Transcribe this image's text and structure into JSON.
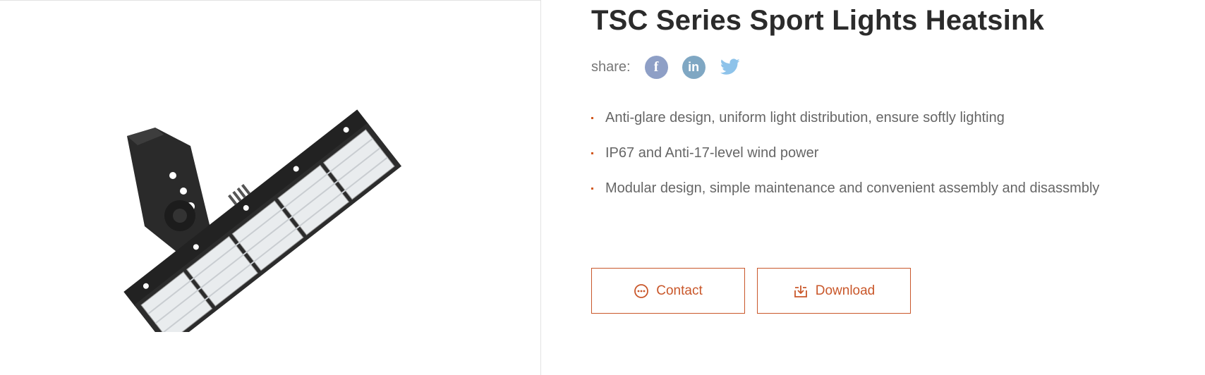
{
  "product": {
    "title": "TSC Series Sport Lights Heatsink",
    "image_icon": "floodlight-product-image"
  },
  "share": {
    "label": "share:",
    "icons": [
      "facebook-icon",
      "linkedin-icon",
      "twitter-icon"
    ],
    "facebook_glyph": "f",
    "linkedin_glyph": "in"
  },
  "features": [
    "Anti-glare design, uniform light distribution, ensure softly lighting",
    "IP67 and Anti-17-level wind power",
    "Modular design, simple maintenance and convenient assembly and disassmbly"
  ],
  "buttons": {
    "contact": "Contact",
    "download": "Download"
  },
  "colors": {
    "accent": "#c9572a",
    "facebook": "#8e9fc6",
    "linkedin": "#7fa7c3",
    "twitter": "#8ec3ea"
  }
}
